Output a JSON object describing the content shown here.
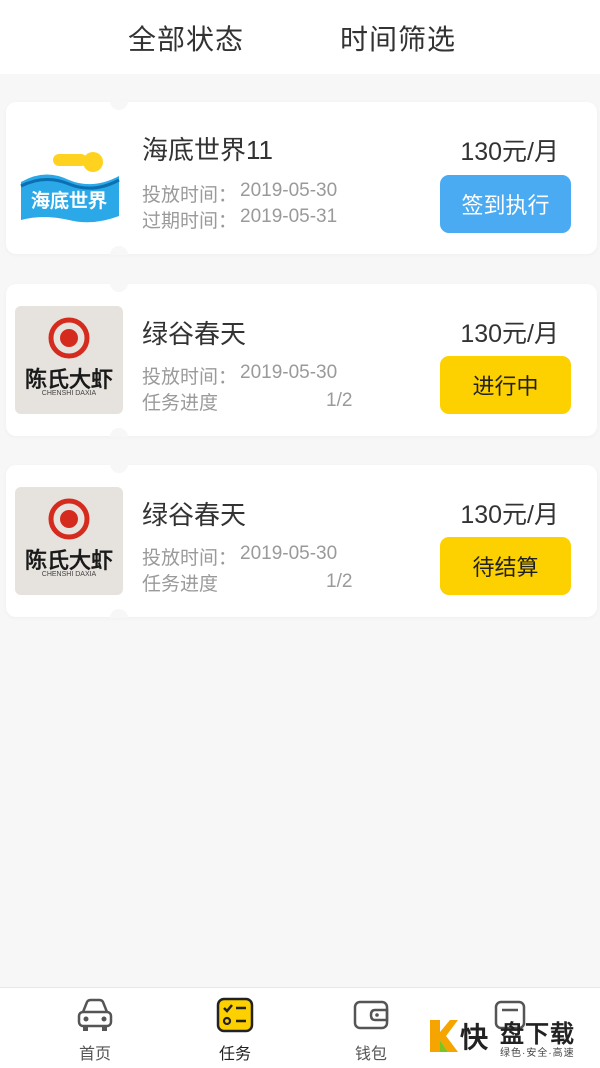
{
  "filters": {
    "status": "全部状态",
    "time": "时间筛选"
  },
  "tasks": [
    {
      "name": "海底世界11",
      "price": "130元/月",
      "meta1_label": "投放时间：",
      "meta1_value": "2019-05-30",
      "meta2_label": "过期时间：",
      "meta2_value": "2019-05-31",
      "action": "签到执行",
      "action_color": "#4aaaf2"
    },
    {
      "name": "绿谷春天",
      "price": "130元/月",
      "meta1_label": "投放时间：",
      "meta1_value": "2019-05-30",
      "meta2_label": "任务进度",
      "meta2_value": "1/2",
      "action": "进行中",
      "action_color": "#fdd000"
    },
    {
      "name": "绿谷春天",
      "price": "130元/月",
      "meta1_label": "投放时间：",
      "meta1_value": "2019-05-30",
      "meta2_label": "任务进度",
      "meta2_value": "1/2",
      "action": "待结算",
      "action_color": "#fdd000"
    }
  ],
  "tabbar": {
    "items": [
      {
        "label": "首页",
        "icon": "car-icon"
      },
      {
        "label": "任务",
        "icon": "task-list-icon",
        "active": true
      },
      {
        "label": "钱包",
        "icon": "wallet-icon"
      },
      {
        "label": "",
        "icon": "profile-icon"
      }
    ]
  },
  "watermark": {
    "brand": "盘下载",
    "prefix": "快",
    "slogan": "绿色·安全·高速"
  },
  "logos": {
    "ocean": "海底世界",
    "shrimp": "陈氏大虾",
    "shrimp_sub": "CHENSHI DAXIA"
  }
}
